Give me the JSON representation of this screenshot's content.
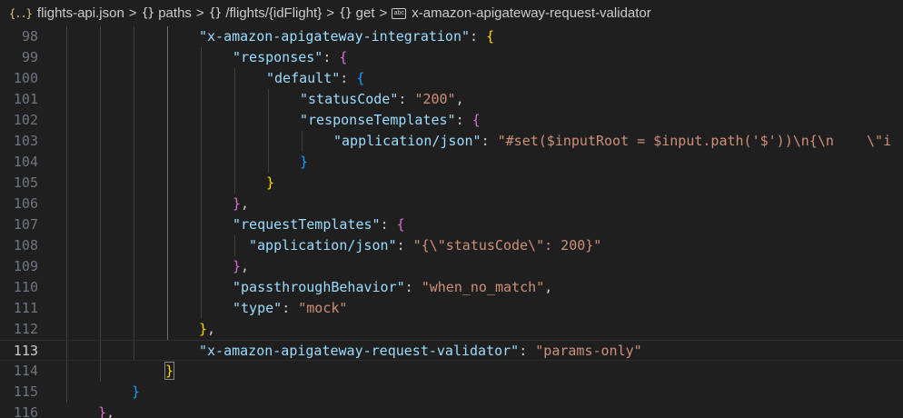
{
  "breadcrumb": {
    "file": "flights-api.json",
    "items": [
      "paths",
      "/flights/{idFlight}",
      "get",
      "x-amazon-apigateway-request-validator"
    ],
    "separator": ">"
  },
  "editor": {
    "current_line": "113",
    "lines": [
      {
        "n": "98",
        "text": "\"x-amazon-apigateway-integration\": {"
      },
      {
        "n": "99",
        "text": "\"responses\": {"
      },
      {
        "n": "100",
        "text": "\"default\": {"
      },
      {
        "n": "101",
        "text": "\"statusCode\": \"200\","
      },
      {
        "n": "102",
        "text": "\"responseTemplates\": {"
      },
      {
        "n": "103",
        "text": "\"application/json\": \"#set($inputRoot = $input.path('$'))\\n{\\n    \\\"i"
      },
      {
        "n": "104",
        "text": "}"
      },
      {
        "n": "105",
        "text": "}"
      },
      {
        "n": "106",
        "text": "},"
      },
      {
        "n": "107",
        "text": "\"requestTemplates\": {"
      },
      {
        "n": "108",
        "text": "\"application/json\": \"{\\\"statusCode\\\": 200}\""
      },
      {
        "n": "109",
        "text": "},"
      },
      {
        "n": "110",
        "text": "\"passthroughBehavior\": \"when_no_match\","
      },
      {
        "n": "111",
        "text": "\"type\": \"mock\""
      },
      {
        "n": "112",
        "text": "},"
      },
      {
        "n": "113",
        "text": "\"x-amazon-apigateway-request-validator\": \"params-only\""
      },
      {
        "n": "114",
        "text": "}"
      },
      {
        "n": "115",
        "text": "}"
      },
      {
        "n": "116",
        "text": "},"
      }
    ]
  },
  "colors": {
    "key": "#9cdcfe",
    "string": "#ce9178",
    "brace_level1": "#da70d6",
    "brace_level2": "#179fff",
    "brace_level3": "#ffd700",
    "background": "#1f1f1f"
  },
  "icons": {
    "file": "json-braces-icon",
    "object": "braces-icon",
    "property": "abc-string-icon",
    "separator": "chevron-right-icon"
  }
}
